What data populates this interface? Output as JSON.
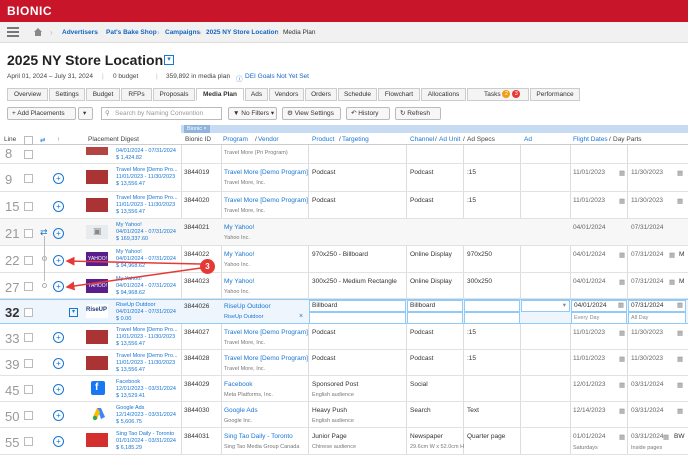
{
  "app": {
    "logo": "BIONIC"
  },
  "breadcrumbs": [
    "Advertisers",
    "Pat's Bake Shop",
    "Campaigns",
    "2025 NY Store Location",
    "Media Plan"
  ],
  "page": {
    "title": "2025 NY Store Location",
    "dates": "April 01, 2024 – July 31, 2024",
    "budget": "0 budget",
    "media_plan": "359,892 in media plan",
    "dei": "DEI Goals Not Yet Set"
  },
  "tabs": [
    {
      "label": "Overview"
    },
    {
      "label": "Settings"
    },
    {
      "label": "Budget"
    },
    {
      "label": "RFPs"
    },
    {
      "label": "Proposals"
    },
    {
      "label": "Media Plan"
    },
    {
      "label": "Ads"
    },
    {
      "label": "Vendors"
    },
    {
      "label": "Orders"
    },
    {
      "label": "Schedule"
    },
    {
      "label": "Flowchart"
    },
    {
      "label": "Allocations"
    },
    {
      "label": "Tasks"
    },
    {
      "label": "Performance"
    }
  ],
  "task_badges": [
    "2",
    "3"
  ],
  "toolbar": {
    "add_placements": "+ Add Placements",
    "search_placeholder": "Search by Naming Convention",
    "no_filters": "No Filters",
    "view_settings": "View Settings",
    "history": "History",
    "refresh": "Refresh"
  },
  "group_label": "Bionic",
  "columns": {
    "line": "Line",
    "digest": "Placement Digest",
    "bionic_id": "Bionic ID",
    "program": "Program",
    "vendor": "Vendor",
    "product": "Product",
    "targeting": "Targeting",
    "channel": "Channel",
    "ad_unit": "Ad Unit",
    "ad_specs": "Ad Specs",
    "ad": "Ad",
    "flight_dates": "Flight Dates",
    "day_parts": "Day Parts"
  },
  "rows": [
    {
      "line": "8",
      "d1": "04/01/2024 - 07/31/2024",
      "d2": "$ 1,424.82",
      "id": "",
      "program": "",
      "vendor": "Travel More (Pri Program)",
      "product": "",
      "channel": "",
      "specs": "",
      "start": "",
      "end": "",
      "extra": ""
    },
    {
      "line": "9",
      "d0": "Travel More [Demo Pro...",
      "d1": "11/01/2023 - 11/30/2023",
      "d2": "$ 13,556.47",
      "id": "3844019",
      "program": "Travel More [Demo Program]",
      "vendor": "Travel More, Inc.",
      "product": "Podcast",
      "channel": "Podcast",
      "specs": ":15",
      "start": "11/01/2023",
      "end": "11/30/2023",
      "extra": ""
    },
    {
      "line": "15",
      "d0": "Travel More [Demo Pro...",
      "d1": "11/01/2023 - 11/30/2023",
      "d2": "$ 13,556.47",
      "id": "3844020",
      "program": "Travel More [Demo Program]",
      "vendor": "Travel More, Inc.",
      "product": "Podcast",
      "channel": "Podcast",
      "specs": ":15",
      "start": "11/01/2023",
      "end": "11/30/2023",
      "extra": ""
    },
    {
      "line": "21",
      "d0": "My Yahoo!",
      "d1": "04/01/2024 - 07/31/2024",
      "d2": "$ 169,337.60",
      "id": "3844021",
      "program": "My Yahoo!",
      "vendor": "Yahoo Inc.",
      "product": "",
      "channel": "",
      "specs": "",
      "start": "04/01/2024",
      "end": "07/31/2024",
      "extra": ""
    },
    {
      "line": "22",
      "d0": "My Yahoo!",
      "d1": "04/01/2024 - 07/31/2024",
      "d2": "$ 94,968.62",
      "id": "3844022",
      "program": "My Yahoo!",
      "vendor": "Yahoo Inc.",
      "product": "970x250 - Billboard",
      "channel": "Online Display",
      "specs": "970x250",
      "start": "04/01/2024",
      "end": "07/31/2024",
      "extra": "M"
    },
    {
      "line": "27",
      "d0": "My Yahoo!",
      "d1": "04/01/2024 - 07/31/2024",
      "d2": "$ 94,968.62",
      "id": "3844023",
      "program": "My Yahoo!",
      "vendor": "Yahoo Inc.",
      "product": "300x250 - Medium Rectangle",
      "channel": "Online Display",
      "specs": "300x250",
      "start": "04/01/2024",
      "end": "07/31/2024",
      "extra": "M"
    },
    {
      "line": "32",
      "d0": "RiseUp Outdoor",
      "d1": "04/01/2024 - 07/31/2024",
      "d2": "$ 0.00",
      "id": "3844026",
      "program": "RiseUp Outdoor",
      "vendor": "RiseUp Outdoor",
      "product": "Billboard",
      "channel": "Billboard",
      "specs": "",
      "start": "04/01/2024",
      "end": "07/31/2024",
      "extra": "",
      "sub_start": "Every Day",
      "sub_end": "All Day"
    },
    {
      "line": "33",
      "d0": "Travel More [Demo Pro...",
      "d1": "11/01/2023 - 11/30/2023",
      "d2": "$ 13,556.47",
      "id": "3844027",
      "program": "Travel More [Demo Program]",
      "vendor": "Travel More, Inc.",
      "product": "Podcast",
      "channel": "Podcast",
      "specs": ":15",
      "start": "11/01/2023",
      "end": "11/30/2023",
      "extra": ""
    },
    {
      "line": "39",
      "d0": "Travel More [Demo Pro...",
      "d1": "11/01/2023 - 11/30/2023",
      "d2": "$ 13,556.47",
      "id": "3844028",
      "program": "Travel More [Demo Program]",
      "vendor": "Travel More, Inc.",
      "product": "Podcast",
      "channel": "Podcast",
      "specs": ":15",
      "start": "11/01/2023",
      "end": "11/30/2023",
      "extra": ""
    },
    {
      "line": "45",
      "d0": "Facebook",
      "d1": "12/01/2023 - 03/31/2024",
      "d2": "$ 13,529.41",
      "id": "3844029",
      "program": "Facebook",
      "vendor": "Meta Platforms, Inc.",
      "product": "Sponsored Post",
      "product_sub": "English audience",
      "channel": "Social",
      "specs": "",
      "start": "12/01/2023",
      "end": "03/31/2024",
      "extra": ""
    },
    {
      "line": "50",
      "d0": "Google Ads",
      "d1": "12/14/2023 - 03/31/2024",
      "d2": "$ 5,606.75",
      "id": "3844030",
      "program": "Google Ads",
      "vendor": "Google Inc.",
      "product": "Heavy Push",
      "product_sub": "English audience",
      "channel": "Search",
      "specs": "Text",
      "start": "12/14/2023",
      "end": "03/31/2024",
      "extra": ""
    },
    {
      "line": "55",
      "d0": "Sing Tao Daily - Toronto",
      "d1": "01/01/2024 - 03/31/2024",
      "d2": "$ 6,185.29",
      "id": "3844031",
      "program": "Sing Tao Daily - Toronto",
      "vendor": "Sing Tao Media Group Canada",
      "product": "Junior Page",
      "product_sub": "Chinese audience",
      "channel": "Newspaper",
      "channel_sub": "29.6cm W x 52.0cm H",
      "specs": "Quarter page",
      "start": "01/01/2024",
      "end": "03/31/2024",
      "extra": "BW",
      "sub_start": "Saturdays",
      "sub_end": "Inside pages"
    }
  ],
  "callout": "3",
  "colors": {
    "brand": "#c8152a",
    "link": "#1976d2",
    "callout": "#e53935"
  }
}
